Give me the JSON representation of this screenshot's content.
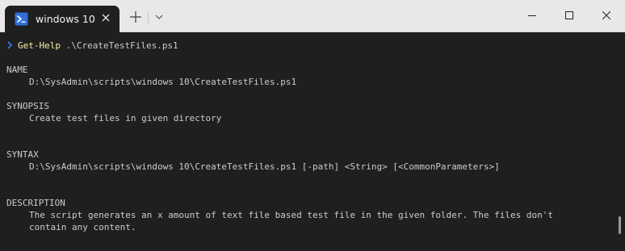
{
  "window": {
    "tab_title": "windows 10",
    "tab_icon": "powershell-icon",
    "accent": "#2f6fd6"
  },
  "terminal": {
    "prompt": {
      "command": "Get-Help",
      "argument": " .\\CreateTestFiles.ps1"
    },
    "sections": [
      {
        "heading": "NAME",
        "lines": [
          "D:\\SysAdmin\\scripts\\windows 10\\CreateTestFiles.ps1"
        ]
      },
      {
        "heading": "SYNOPSIS",
        "lines": [
          "Create test files in given directory"
        ]
      },
      {
        "heading": "SYNTAX",
        "lines": [
          "D:\\SysAdmin\\scripts\\windows 10\\CreateTestFiles.ps1 [-path] <String> [<CommonParameters>]"
        ]
      },
      {
        "heading": "DESCRIPTION",
        "lines": [
          "The script generates an x amount of text file based test file in the given folder. The files don't",
          "contain any content."
        ]
      }
    ]
  }
}
